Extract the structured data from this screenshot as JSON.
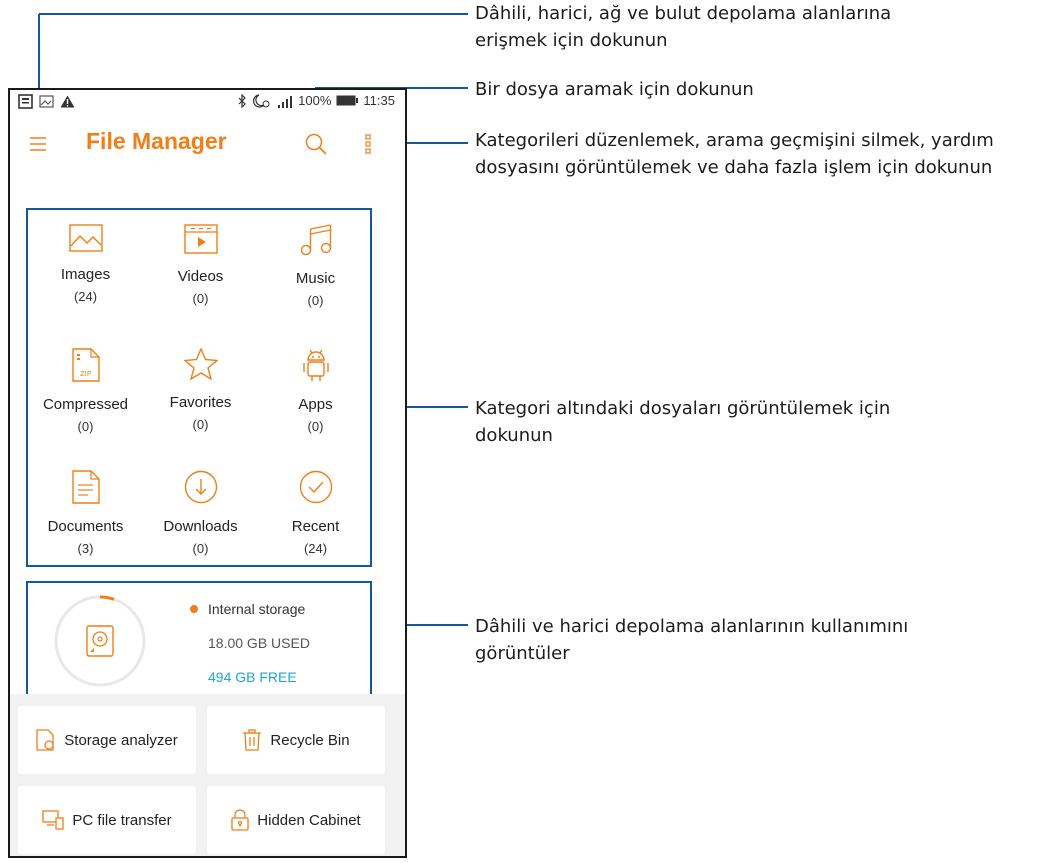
{
  "status_bar": {
    "battery": "100%",
    "time": "11:35"
  },
  "app": {
    "title": "File Manager"
  },
  "categories": [
    {
      "label": "Images",
      "count": "(24)",
      "icon": "image-icon"
    },
    {
      "label": "Videos",
      "count": "(0)",
      "icon": "video-icon"
    },
    {
      "label": "Music",
      "count": "(0)",
      "icon": "music-icon"
    },
    {
      "label": "Compressed",
      "count": "(0)",
      "icon": "zip-icon"
    },
    {
      "label": "Favorites",
      "count": "(0)",
      "icon": "star-icon"
    },
    {
      "label": "Apps",
      "count": "(0)",
      "icon": "android-icon"
    },
    {
      "label": "Documents",
      "count": "(3)",
      "icon": "document-icon"
    },
    {
      "label": "Downloads",
      "count": "(0)",
      "icon": "download-icon"
    },
    {
      "label": "Recent",
      "count": "(24)",
      "icon": "recent-icon"
    }
  ],
  "storage": {
    "name": "Internal storage",
    "used": "18.00 GB USED",
    "free": "494 GB FREE"
  },
  "tools": [
    {
      "label": "Storage analyzer",
      "icon": "storage-analyzer-icon"
    },
    {
      "label": "Recycle Bin",
      "icon": "recycle-bin-icon"
    },
    {
      "label": "PC file transfer",
      "icon": "pc-transfer-icon"
    },
    {
      "label": "Hidden Cabinet",
      "icon": "lock-icon"
    }
  ],
  "callouts": {
    "menu": "Dâhili, harici, ağ ve bulut depolama alanlarına erişmek için dokunun",
    "search": "Bir dosya aramak için dokunun",
    "more": "Kategorileri düzenlemek, arama geçmişini silmek, yardım dosyasını görüntülemek ve daha fazla işlem için dokunun",
    "categories": "Kategori altındaki dosyaları görüntülemek için dokunun",
    "storage": "Dâhili ve harici depolama alanlarının kullanımını görüntüler"
  },
  "colors": {
    "accent": "#f07f17",
    "callout_frame": "#14579b",
    "free_text": "#1fa5d6"
  }
}
